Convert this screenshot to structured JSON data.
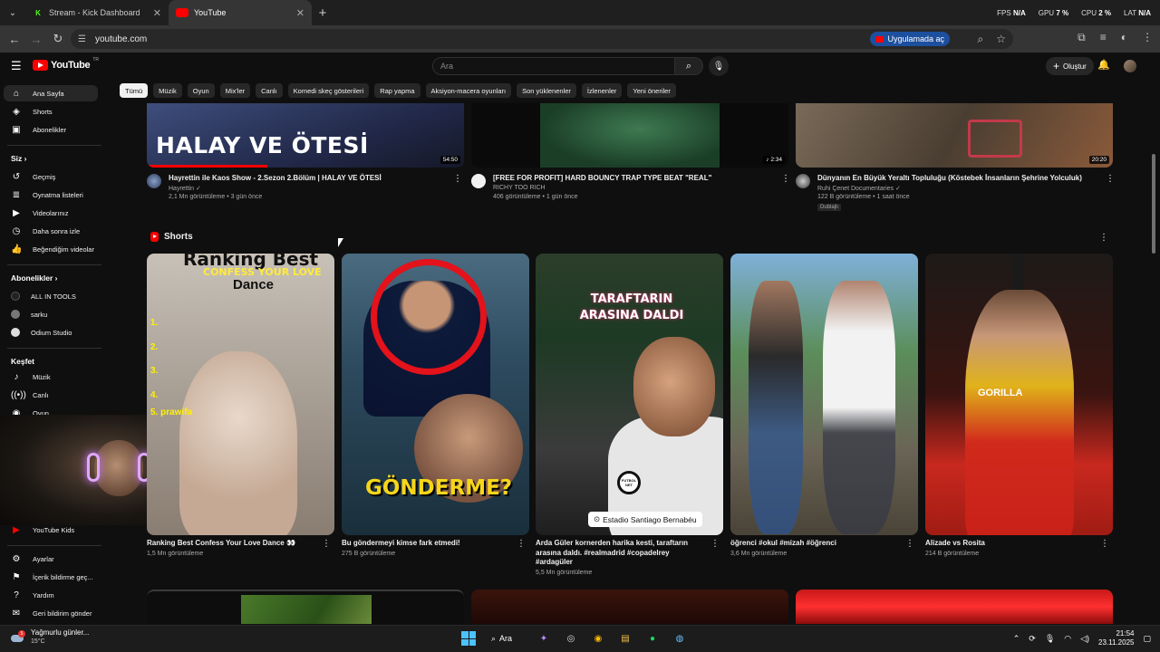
{
  "browser": {
    "tabs": [
      {
        "title": "Stream - Kick Dashboard",
        "icon": "kick-icon",
        "active": false
      },
      {
        "title": "YouTube",
        "icon": "youtube-icon",
        "active": true
      }
    ],
    "url": "youtube.com",
    "open_in_app": "Uygulamada aç",
    "stats": {
      "fps_label": "FPS",
      "fps": "N/A",
      "gpu_label": "GPU",
      "gpu": "7 %",
      "cpu_label": "CPU",
      "cpu": "2 %",
      "lat_label": "LAT",
      "lat": "N/A"
    }
  },
  "masthead": {
    "logo": "YouTube",
    "region": "TR",
    "search_placeholder": "Ara",
    "create_label": "Oluştur"
  },
  "chips": [
    "Tümü",
    "Müzik",
    "Oyun",
    "Mix'ler",
    "Canlı",
    "Komedi skeç gösterileri",
    "Rap yapma",
    "Aksiyon-macera oyunları",
    "Son yüklenenler",
    "İzlenenler",
    "Yeni öneriler"
  ],
  "sidebar": {
    "home": "Ana Sayfa",
    "shorts": "Shorts",
    "subscriptions": "Abonelikler",
    "you_head": "Siz",
    "you_items": [
      "Geçmiş",
      "Oynatma listeleri",
      "Videolarınız",
      "Daha sonra izle",
      "Beğendiğim videolar"
    ],
    "subs_head": "Abonelikler",
    "subs_items": [
      "ALL IN TOOLS",
      "sarku",
      "Odium Studio"
    ],
    "explore_head": "Keşfet",
    "explore_items": [
      "Müzik",
      "Canlı",
      "Oyun"
    ],
    "kids": "YouTube Kids",
    "bottom_items": [
      "Ayarlar",
      "İçerik bildirme geç...",
      "Yardım",
      "Geri bildirim gönder"
    ]
  },
  "videos": [
    {
      "title": "Hayrettin ile Kaos Show - 2.Sezon 2.Bölüm | HALAY VE ÖTESİ",
      "channel": "Hayrettin ✓",
      "stats": "2,1 Mn görüntüleme • 3 gün önce",
      "duration": "54:50",
      "overlay": "HALAY VE ÖTESİ",
      "progress": 0.38
    },
    {
      "title": "[FREE FOR PROFIT] HARD BOUNCY TRAP TYPE BEAT \"REAL\"",
      "channel": "RICHY TOO RICH",
      "stats": "406 görüntüleme • 1 gün önce",
      "duration": "♪ 2:34"
    },
    {
      "title": "Dünyanın En Büyük Yeraltı Topluluğu (Köstebek İnsanların Şehrine Yolculuk)",
      "channel": "Ruhi Çenet Documentaries ✓",
      "stats": "122 B görüntüleme • 1 saat önce",
      "duration": "20:20",
      "badge": "Dublajlı"
    }
  ],
  "shorts": {
    "heading": "Shorts",
    "items": [
      {
        "title": "Ranking Best Confess Your Love Dance 👀",
        "views": "1,5 Mn görüntüleme",
        "overlay": {
          "l1": "Ranking Best",
          "l2": "CONFESS YOUR LOVE",
          "l3": "Dance",
          "nums": "1.\n2.\n3.\n4.",
          "n5": "5. prawifa"
        }
      },
      {
        "title": "Bu göndermeyi kimse fark etmedi!",
        "views": "275 B görüntüleme",
        "overlay": "GÖNDERME?"
      },
      {
        "title": "Arda Güler kornerden harika kesti, taraftarın arasına daldı. #realmadrid #copadelrey #ardagüler",
        "views": "5,5 Mn görüntüleme",
        "overlay": {
          "l1": "TARAFTARIN",
          "l2": "ARASINA DALDI",
          "badge": "FUTBOL NET",
          "location": "Estadio Santiago Bernabéu"
        }
      },
      {
        "title": "öğrenci #okul #mizah #öğrenci",
        "views": "3,6 Mn görüntüleme"
      },
      {
        "title": "Alizade vs Rosita",
        "views": "214 B görüntüleme",
        "overlay": "GORILLA"
      }
    ]
  },
  "taskbar": {
    "weather_text": "Yağmurlu günler...",
    "weather_temp": "15°C",
    "weather_badge": "5",
    "search": "Ara",
    "time": "21:54",
    "date": "23.11.2025"
  },
  "colors": {
    "bg": "#0f0f0f",
    "accent": "#ff0000",
    "chip": "#272727",
    "text": "#f1f1f1",
    "muted": "#aaaaaa"
  }
}
